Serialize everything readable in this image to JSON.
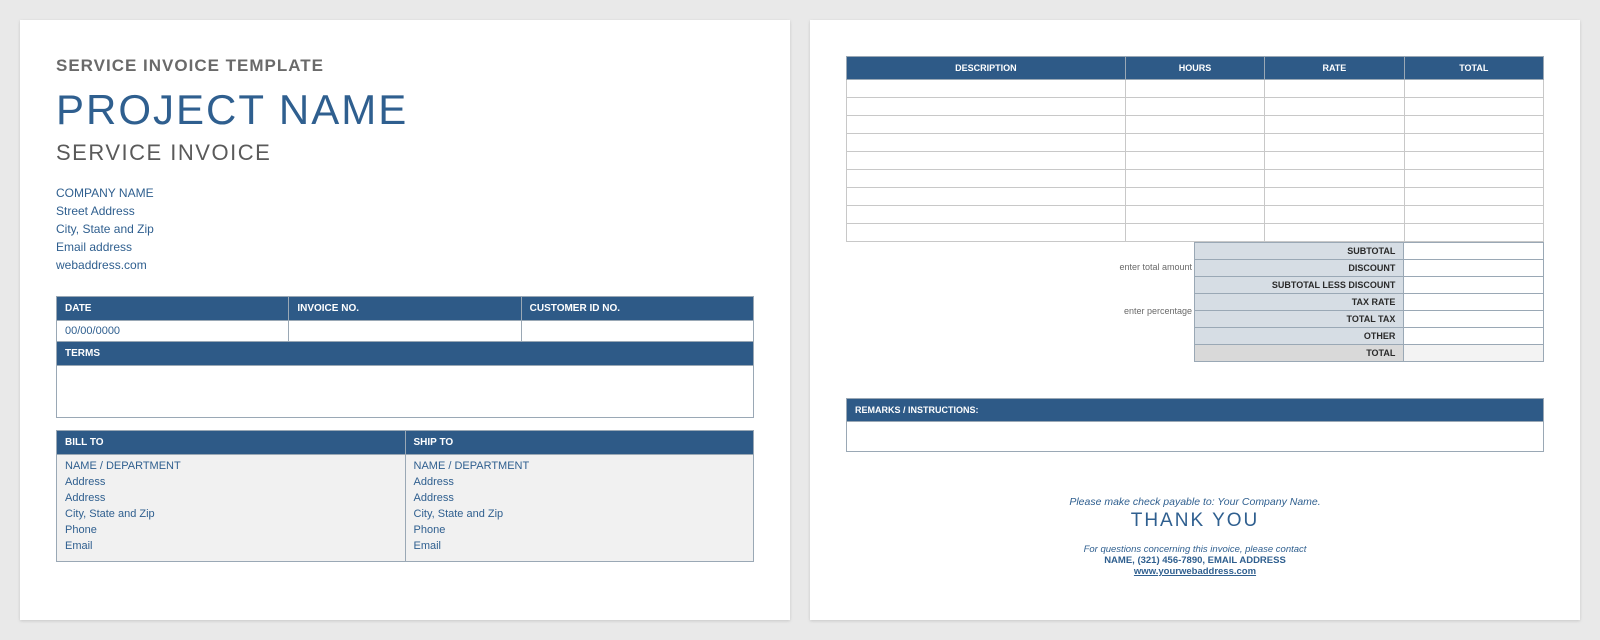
{
  "left": {
    "template_title": "SERVICE INVOICE TEMPLATE",
    "project": "PROJECT NAME",
    "subtitle": "SERVICE INVOICE",
    "company": {
      "name": "COMPANY NAME",
      "street": "Street Address",
      "csz": "City, State and Zip",
      "email": "Email address",
      "web": "webaddress.com"
    },
    "info_headers": {
      "date": "DATE",
      "invoice": "INVOICE NO.",
      "cust": "CUSTOMER ID NO."
    },
    "info_values": {
      "date": "00/00/0000",
      "invoice": "",
      "cust": ""
    },
    "terms_label": "TERMS",
    "party_headers": {
      "bill": "BILL TO",
      "ship": "SHIP TO"
    },
    "bill_to": [
      "NAME / DEPARTMENT",
      "Address",
      "Address",
      "City, State and Zip",
      "Phone",
      "Email"
    ],
    "ship_to": [
      "NAME / DEPARTMENT",
      "Address",
      "Address",
      "City, State and Zip",
      "Phone",
      "Email"
    ]
  },
  "right": {
    "cols": {
      "desc": "DESCRIPTION",
      "hours": "HOURS",
      "rate": "RATE",
      "total": "TOTAL"
    },
    "rows": 9,
    "hints": {
      "amount": "enter total amount",
      "percent": "enter percentage"
    },
    "totals_labels": [
      "SUBTOTAL",
      "DISCOUNT",
      "SUBTOTAL LESS DISCOUNT",
      "TAX RATE",
      "TOTAL TAX",
      "OTHER",
      "TOTAL"
    ],
    "remarks_label": "REMARKS / INSTRUCTIONS:",
    "footer": {
      "payable": "Please make check payable to: Your Company Name.",
      "thank": "THANK YOU",
      "questions": "For questions concerning this invoice, please contact",
      "contact": "NAME, (321) 456-7890, EMAIL ADDRESS",
      "url": "www.yourwebaddress.com"
    }
  }
}
